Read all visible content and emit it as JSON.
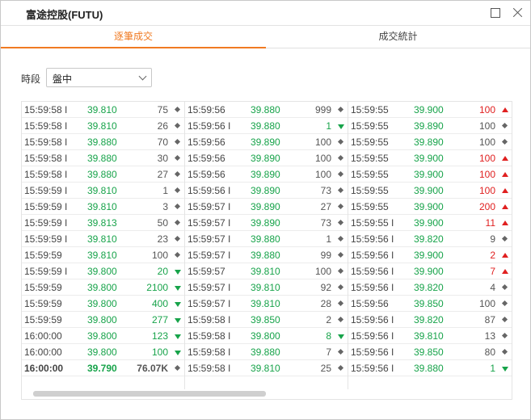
{
  "window": {
    "title": "富途控股(FUTU)"
  },
  "tabs": [
    {
      "label": "逐筆成交",
      "active": true
    },
    {
      "label": "成交統計",
      "active": false
    }
  ],
  "period": {
    "label": "時段",
    "selected": "盤中"
  },
  "colors": {
    "accent": "#f07a22",
    "up": "#e02020",
    "down": "#17a34a",
    "neutral": "#555555"
  },
  "trades": [
    [
      {
        "time": "15:59:58 I",
        "price": "39.810",
        "volume": "75",
        "dir": "flat"
      },
      {
        "time": "15:59:58 I",
        "price": "39.810",
        "volume": "26",
        "dir": "flat"
      },
      {
        "time": "15:59:58 I",
        "price": "39.880",
        "volume": "70",
        "dir": "flat"
      },
      {
        "time": "15:59:58 I",
        "price": "39.880",
        "volume": "30",
        "dir": "flat"
      },
      {
        "time": "15:59:58 I",
        "price": "39.880",
        "volume": "27",
        "dir": "flat"
      },
      {
        "time": "15:59:59 I",
        "price": "39.810",
        "volume": "1",
        "dir": "flat"
      },
      {
        "time": "15:59:59 I",
        "price": "39.810",
        "volume": "3",
        "dir": "flat"
      },
      {
        "time": "15:59:59 I",
        "price": "39.813",
        "volume": "50",
        "dir": "flat"
      },
      {
        "time": "15:59:59 I",
        "price": "39.810",
        "volume": "23",
        "dir": "flat"
      },
      {
        "time": "15:59:59",
        "price": "39.810",
        "volume": "100",
        "dir": "flat"
      },
      {
        "time": "15:59:59 I",
        "price": "39.800",
        "volume": "20",
        "dir": "down"
      },
      {
        "time": "15:59:59",
        "price": "39.800",
        "volume": "2100",
        "dir": "down"
      },
      {
        "time": "15:59:59",
        "price": "39.800",
        "volume": "400",
        "dir": "down"
      },
      {
        "time": "15:59:59",
        "price": "39.800",
        "volume": "277",
        "dir": "down"
      },
      {
        "time": "16:00:00",
        "price": "39.800",
        "volume": "123",
        "dir": "down"
      },
      {
        "time": "16:00:00",
        "price": "39.800",
        "volume": "100",
        "dir": "down"
      },
      {
        "time": "16:00:00",
        "price": "39.790",
        "volume": "76.07K",
        "dir": "flat",
        "bold": true
      }
    ],
    [
      {
        "time": "15:59:56",
        "price": "39.880",
        "volume": "999",
        "dir": "flat"
      },
      {
        "time": "15:59:56 I",
        "price": "39.880",
        "volume": "1",
        "dir": "down"
      },
      {
        "time": "15:59:56",
        "price": "39.890",
        "volume": "100",
        "dir": "flat"
      },
      {
        "time": "15:59:56",
        "price": "39.890",
        "volume": "100",
        "dir": "flat"
      },
      {
        "time": "15:59:56",
        "price": "39.890",
        "volume": "100",
        "dir": "flat"
      },
      {
        "time": "15:59:56 I",
        "price": "39.890",
        "volume": "73",
        "dir": "flat"
      },
      {
        "time": "15:59:57 I",
        "price": "39.890",
        "volume": "27",
        "dir": "flat"
      },
      {
        "time": "15:59:57 I",
        "price": "39.890",
        "volume": "73",
        "dir": "flat"
      },
      {
        "time": "15:59:57 I",
        "price": "39.880",
        "volume": "1",
        "dir": "flat"
      },
      {
        "time": "15:59:57 I",
        "price": "39.880",
        "volume": "99",
        "dir": "flat"
      },
      {
        "time": "15:59:57",
        "price": "39.810",
        "volume": "100",
        "dir": "flat"
      },
      {
        "time": "15:59:57 I",
        "price": "39.810",
        "volume": "92",
        "dir": "flat"
      },
      {
        "time": "15:59:57 I",
        "price": "39.810",
        "volume": "28",
        "dir": "flat"
      },
      {
        "time": "15:59:58 I",
        "price": "39.850",
        "volume": "2",
        "dir": "flat"
      },
      {
        "time": "15:59:58 I",
        "price": "39.800",
        "volume": "8",
        "dir": "down"
      },
      {
        "time": "15:59:58 I",
        "price": "39.880",
        "volume": "7",
        "dir": "flat"
      },
      {
        "time": "15:59:58 I",
        "price": "39.810",
        "volume": "25",
        "dir": "flat"
      }
    ],
    [
      {
        "time": "15:59:55",
        "price": "39.900",
        "volume": "100",
        "dir": "up"
      },
      {
        "time": "15:59:55",
        "price": "39.890",
        "volume": "100",
        "dir": "flat"
      },
      {
        "time": "15:59:55",
        "price": "39.890",
        "volume": "100",
        "dir": "flat"
      },
      {
        "time": "15:59:55",
        "price": "39.900",
        "volume": "100",
        "dir": "up"
      },
      {
        "time": "15:59:55",
        "price": "39.900",
        "volume": "100",
        "dir": "up"
      },
      {
        "time": "15:59:55",
        "price": "39.900",
        "volume": "100",
        "dir": "up"
      },
      {
        "time": "15:59:55",
        "price": "39.900",
        "volume": "200",
        "dir": "up"
      },
      {
        "time": "15:59:55 I",
        "price": "39.900",
        "volume": "11",
        "dir": "up"
      },
      {
        "time": "15:59:56 I",
        "price": "39.820",
        "volume": "9",
        "dir": "flat"
      },
      {
        "time": "15:59:56 I",
        "price": "39.900",
        "volume": "2",
        "dir": "up"
      },
      {
        "time": "15:59:56 I",
        "price": "39.900",
        "volume": "7",
        "dir": "up"
      },
      {
        "time": "15:59:56 I",
        "price": "39.820",
        "volume": "4",
        "dir": "flat"
      },
      {
        "time": "15:59:56",
        "price": "39.850",
        "volume": "100",
        "dir": "flat"
      },
      {
        "time": "15:59:56 I",
        "price": "39.820",
        "volume": "87",
        "dir": "flat"
      },
      {
        "time": "15:59:56 I",
        "price": "39.810",
        "volume": "13",
        "dir": "flat"
      },
      {
        "time": "15:59:56 I",
        "price": "39.850",
        "volume": "80",
        "dir": "flat"
      },
      {
        "time": "15:59:56 I",
        "price": "39.880",
        "volume": "1",
        "dir": "down"
      }
    ]
  ]
}
